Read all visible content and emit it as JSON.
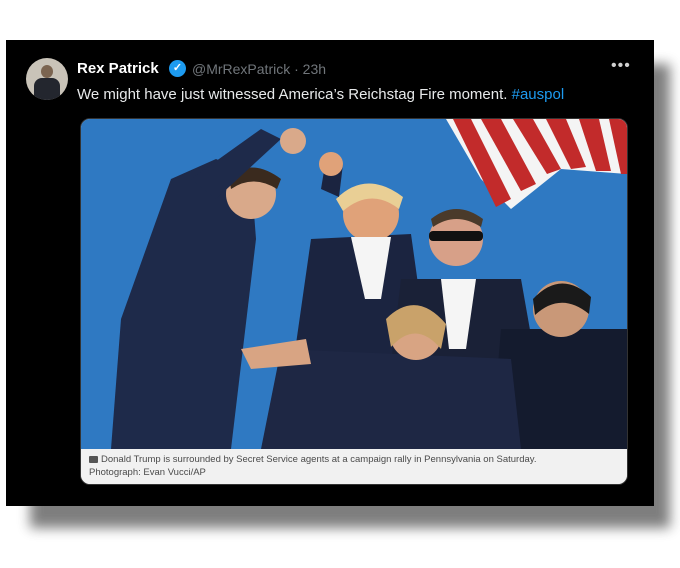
{
  "tweet": {
    "display_name": "Rex Patrick",
    "handle": "@MrRexPatrick",
    "separator": "·",
    "time_ago": "23h",
    "text": "We might have just witnessed America’s Reichstag Fire moment.",
    "hashtag": "#auspol",
    "more_icon": "more-horizontal-icon",
    "verified_icon": "verified-badge-icon"
  },
  "photo": {
    "caption_line1": "Donald Trump is surrounded by Secret Service agents at a campaign rally in Pennsylvania on Saturday.",
    "caption_line2": "Photograph: Evan Vucci/AP",
    "camera_icon": "camera-icon"
  },
  "colors": {
    "background": "#000000",
    "text": "#e7e9ea",
    "muted": "#71767b",
    "accent": "#1d9bf0",
    "sky": "#2f79c2"
  }
}
